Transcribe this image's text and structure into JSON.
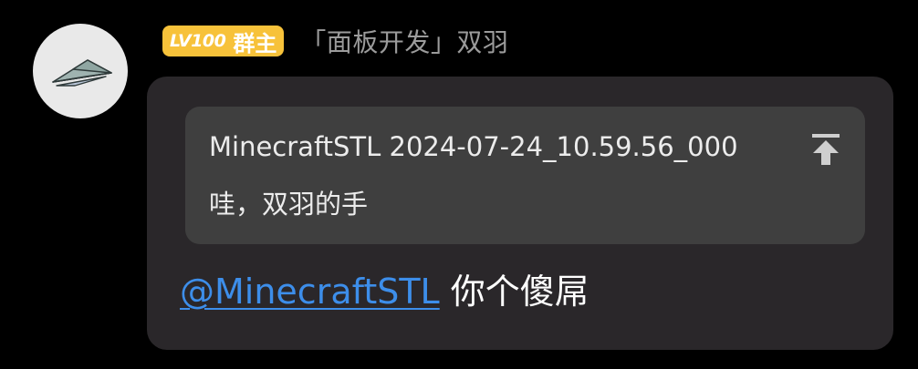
{
  "sender": {
    "avatar_icon": "paper-plane-icon",
    "badge_level": "LV100",
    "badge_role": "群主",
    "badge_color": "#f7c23a",
    "name": "「面板开发」双羽"
  },
  "reply": {
    "quoted_header": "MinecraftSTL 2024-07-24_10.59.56_000",
    "quoted_text": "哇，双羽的手",
    "jump_icon": "jump-to-top-icon"
  },
  "message": {
    "mention": "@MinecraftSTL",
    "mention_color": "#3d8eea",
    "text": "你个傻屌"
  },
  "colors": {
    "background": "#000000",
    "bubble": "#2a272a",
    "quote": "#3f3f3f"
  }
}
